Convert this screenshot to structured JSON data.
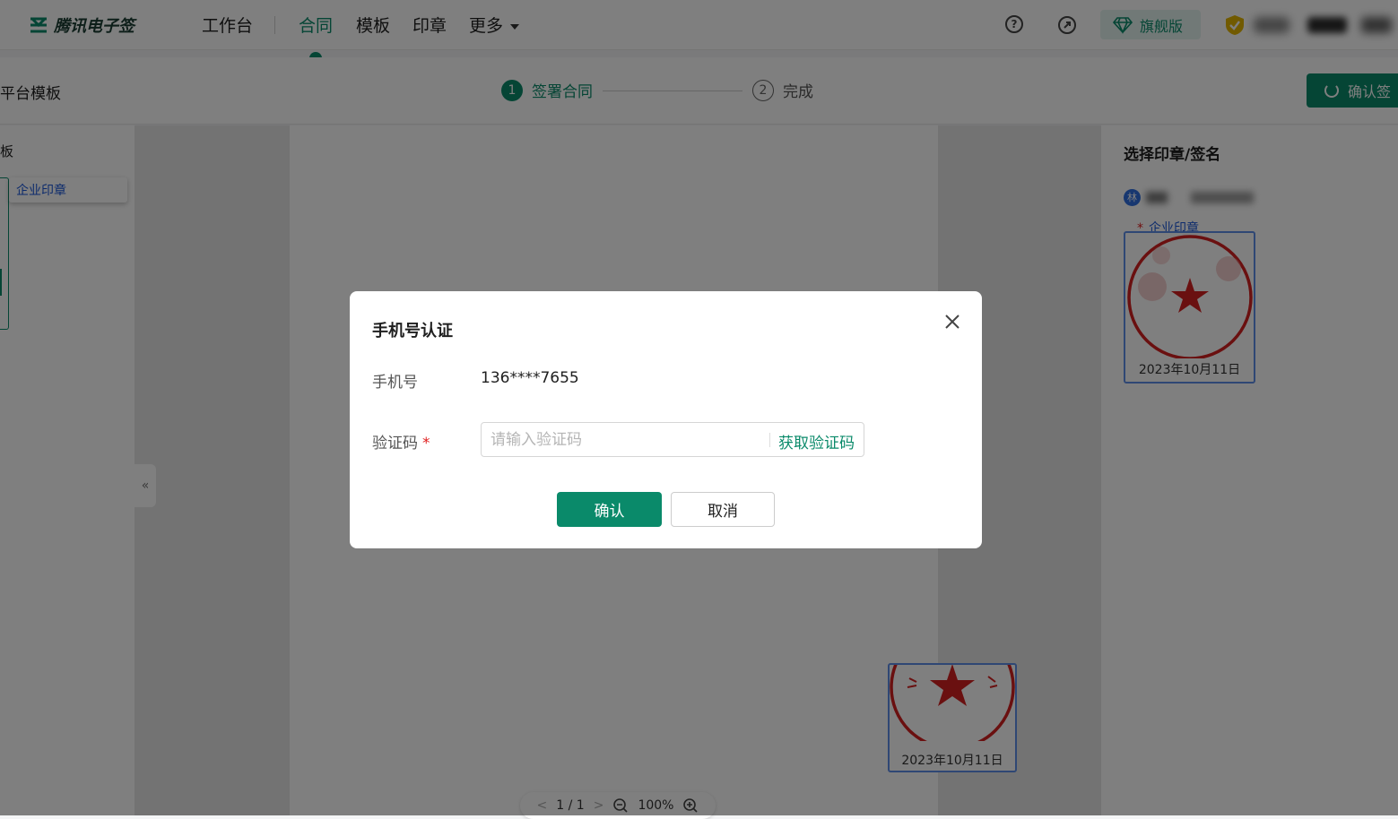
{
  "header": {
    "logo_text": "腾讯电子签",
    "nav": [
      {
        "label": "工作台"
      },
      {
        "label": "合同"
      },
      {
        "label": "模板"
      },
      {
        "label": "印章"
      },
      {
        "label": "更多"
      }
    ],
    "plan_label": "旗舰版"
  },
  "stepbar": {
    "page_title": "平台模板",
    "steps": [
      {
        "num": "1",
        "label": "签署合同"
      },
      {
        "num": "2",
        "label": "完成"
      }
    ],
    "confirm_label": "确认签"
  },
  "left_panel": {
    "title": "板",
    "item_label": "企业印章"
  },
  "document": {
    "seal_date": "2023年10月11日",
    "pager_prev": "<",
    "pager_page": "1 / 1",
    "pager_next": ">",
    "zoom": "100%"
  },
  "right_panel": {
    "title": "选择印章/签名",
    "user_initial": "林",
    "required_label": "企业印章",
    "seal_date": "2023年10月11日"
  },
  "modal": {
    "title": "手机号认证",
    "phone_label": "手机号",
    "phone_value": "136****7655",
    "code_label": "验证码",
    "code_required": "*",
    "code_placeholder": "请输入验证码",
    "get_code_label": "获取验证码",
    "confirm_label": "确认",
    "cancel_label": "取消"
  },
  "colors": {
    "brand": "#0a8a6a",
    "seal_red": "#d42020",
    "frame_blue": "#5f8ee8",
    "overlay": "rgba(0,0,0,0.5)"
  },
  "icons": [
    "logo-icon",
    "help-icon",
    "share-icon",
    "diamond-icon",
    "shield-icon",
    "spinner-icon",
    "collapse-icon",
    "zoom-out-icon",
    "zoom-in-icon",
    "close-icon",
    "seal-star-icon"
  ]
}
